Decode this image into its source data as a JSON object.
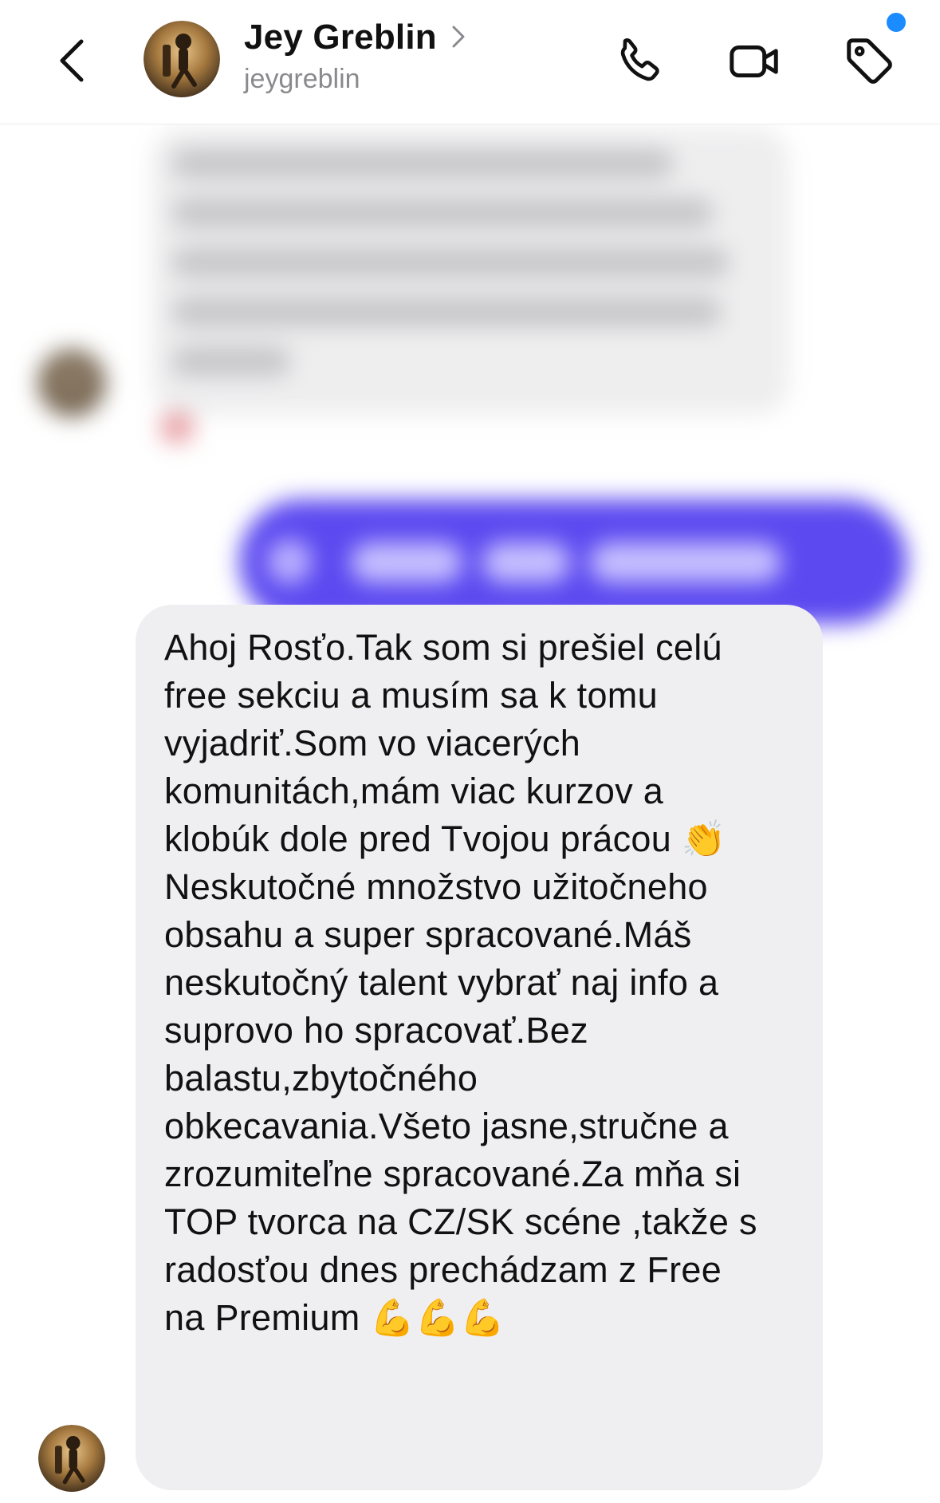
{
  "header": {
    "contact_name": "Jey Greblin",
    "username": "jeygreblin",
    "icons": {
      "back": "chevron-left-icon",
      "chevron": "chevron-right-icon",
      "call": "phone-icon",
      "video": "video-camera-icon",
      "tag": "tag-icon"
    },
    "notification_dot_color": "#1a8cff"
  },
  "thread": {
    "message": {
      "text": "Ahoj Rosťo.Tak som si prešiel celú\nfree sekciu a musím sa k tomu\nvyjadriť.Som vo viacerých\nkomunitách,mám viac kurzov a\nklobúk dole pred Tvojou prácou 👏\nNeskutočné množstvo užitočneho\nobsahu a super spracované.Máš\nneskutočný talent vybrať naj info a\nsuprovo ho spracovať.Bez\nbalastu,zbytočného\nobkecavania.Všeto jasne,stručne a\nzrozumiteľne spracované.Za mňa si\nTOP tvorca na CZ/SK scéne ,takže s\nradosťou dnes prechádzam z Free\nna Premium 💪💪💪",
      "bubble_color": "#efeff1"
    },
    "sent_bubble_color": "#5c49f0"
  },
  "colors": {
    "text": "#111111",
    "secondary_text": "#8a8a8e"
  }
}
